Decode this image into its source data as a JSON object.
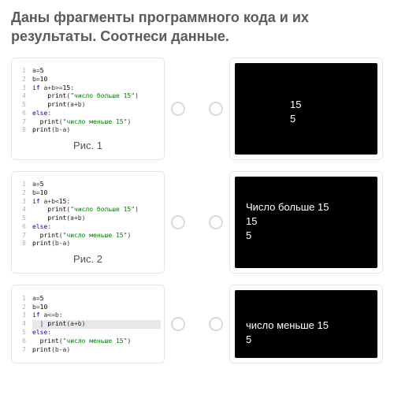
{
  "prompt": "Даны фрагменты программного кода и их результаты. Соотнеси данные.",
  "rows": [
    {
      "caption": "Рис. 1",
      "code": [
        "a=5",
        "b=10",
        "if a+b>=15:",
        "    print(\"число больше 15\")",
        "    print(a+b)",
        "else:",
        "  print(\"число меньше 15\")",
        "print(b-a)"
      ],
      "output": [
        "15",
        "5"
      ]
    },
    {
      "caption": "Рис. 2",
      "code": [
        "a=5",
        "b=10",
        "if a+b<15:",
        "    print(\"число больше 15\")",
        "    print(a+b)",
        "else:",
        "  print(\"число меньше 15\")",
        "print(b-a)"
      ],
      "output": [
        "Число больше 15",
        "15",
        "5"
      ]
    },
    {
      "caption": "",
      "code": [
        "a=5",
        "b=10",
        "if a<=b:",
        "  | print(a+b)",
        "else:",
        "  print(\"число меньше 15\")",
        "print(b-a)"
      ],
      "output": [
        "число меньше 15",
        "5"
      ]
    }
  ]
}
